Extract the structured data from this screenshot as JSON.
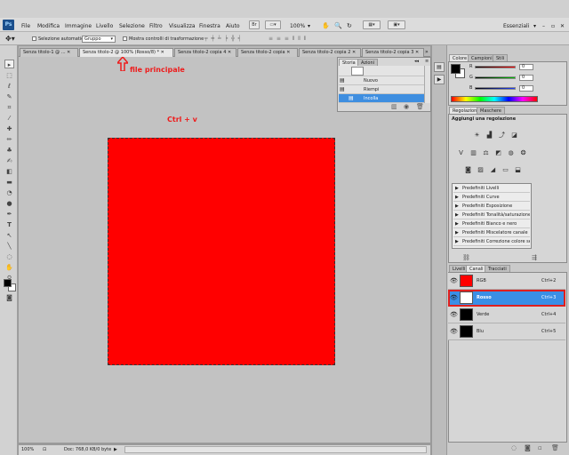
{
  "app": {
    "logo": "Ps",
    "menus": [
      "File",
      "Modifica",
      "Immagine",
      "Livello",
      "Selezione",
      "Filtro",
      "Visualizza",
      "Finestra",
      "Aiuto"
    ],
    "zoom": "100%",
    "workspace": "Essenziali"
  },
  "options_bar": {
    "auto_select_label": "Selezione automatica:",
    "auto_select_value": "Gruppo",
    "transform_controls_label": "Mostra controlli di trasformazione"
  },
  "tabs": [
    {
      "label": "Senza titolo-1 @ ..."
    },
    {
      "label": "Senza titolo-2 @ 100% (Rosso/8) *"
    },
    {
      "label": "Senza titolo-2 copia 4"
    },
    {
      "label": "Senza titolo-2 copia"
    },
    {
      "label": "Senza titolo-2 copia 2"
    },
    {
      "label": "Senza titolo-2 copia 3"
    }
  ],
  "annotations": {
    "main_file": "file principale",
    "shortcut": "Ctrl + v"
  },
  "history_panel": {
    "tabs": [
      "Storia",
      "Azioni"
    ],
    "items": [
      "Nuovo",
      "Riempi",
      "Incolla"
    ],
    "selected_index": 2
  },
  "color_panel": {
    "tabs": [
      "Colore",
      "Campioni",
      "Stili"
    ],
    "channels": [
      {
        "label": "R",
        "value": "0",
        "color": "#ff0000"
      },
      {
        "label": "G",
        "value": "0",
        "color": "#00c000"
      },
      {
        "label": "B",
        "value": "0",
        "color": "#2040ff"
      }
    ]
  },
  "adjustments_panel": {
    "tabs": [
      "Regolazioni",
      "Maschere"
    ],
    "title": "Aggiungi una regolazione",
    "presets": [
      "Predefiniti Livelli",
      "Predefiniti Curve",
      "Predefiniti Esposizione",
      "Predefiniti Tonalità/saturazione",
      "Predefiniti Bianco e nero",
      "Predefiniti Miscelatore canale",
      "Predefiniti Correzione colore sel..."
    ]
  },
  "channels_panel": {
    "tabs": [
      "Livelli",
      "Canali",
      "Tracciati"
    ],
    "channels": [
      {
        "name": "RGB",
        "shortcut": "Ctrl+2",
        "thumb_color": "#ff0000"
      },
      {
        "name": "Rosso",
        "shortcut": "Ctrl+3",
        "thumb_color": "#ffffff"
      },
      {
        "name": "Verde",
        "shortcut": "Ctrl+4",
        "thumb_color": "#000000"
      },
      {
        "name": "Blu",
        "shortcut": "Ctrl+5",
        "thumb_color": "#000000"
      }
    ],
    "selected_index": 1
  },
  "status": {
    "zoom": "100%",
    "doc_info": "Doc: 768,0 KB/0 byte"
  },
  "colors": {
    "canvas_fill": "#ff0000",
    "selection_blue": "#3a8fe6",
    "annotation_red": "#ee1c1c"
  }
}
